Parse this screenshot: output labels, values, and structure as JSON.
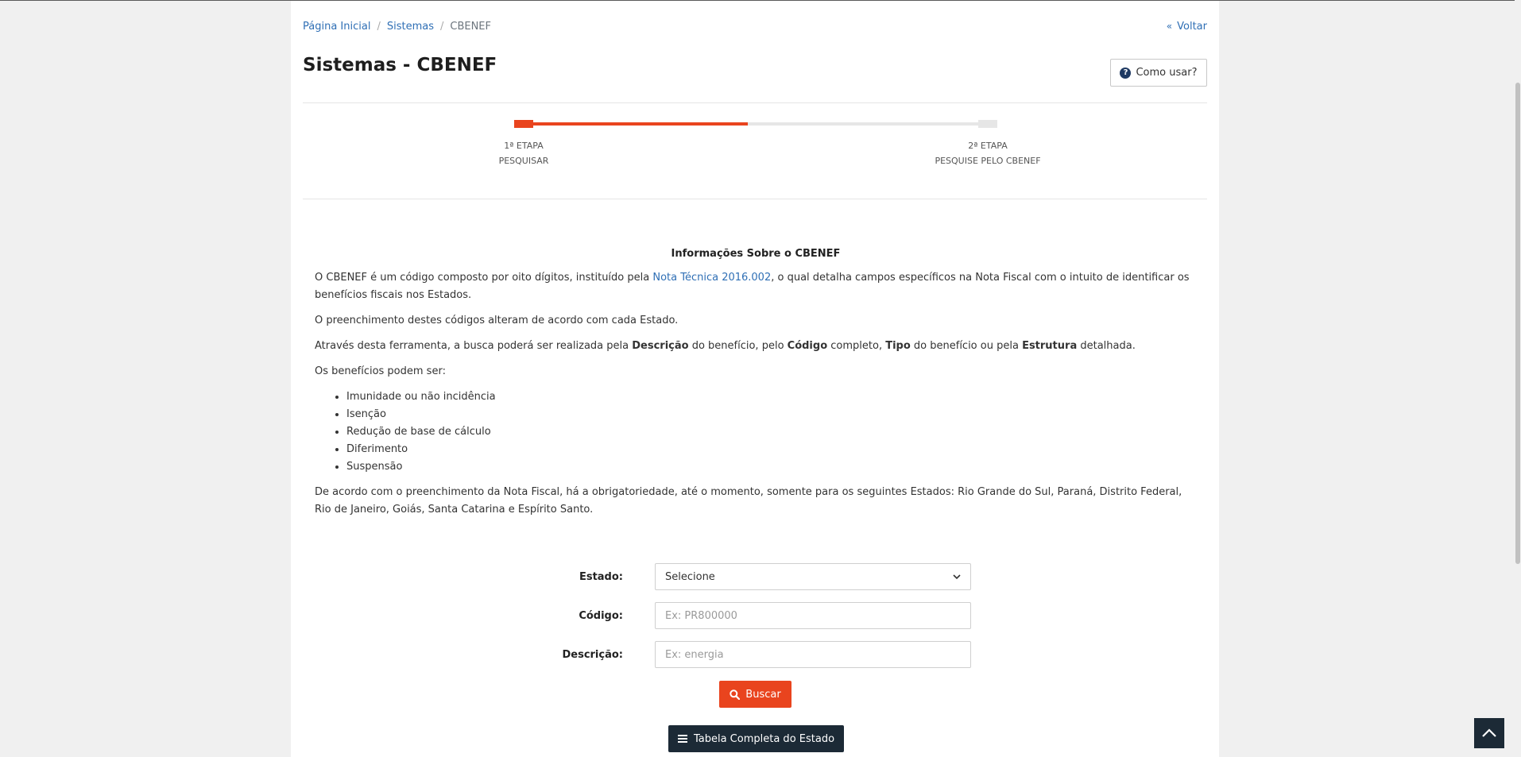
{
  "breadcrumb": {
    "home": "Página Inicial",
    "systems": "Sistemas",
    "current": "CBENEF",
    "separator": "/"
  },
  "back": {
    "chevron": "«",
    "label": "Voltar"
  },
  "header": {
    "title": "Sistemas - CBENEF",
    "help_icon": "question-circle-icon",
    "help_icon_glyph": "?",
    "help_label": "Como usar?"
  },
  "steps": {
    "progress": 0.5,
    "items": [
      {
        "line1": "1ª ETAPA",
        "line2": "PESQUISAR"
      },
      {
        "line1": "2ª ETAPA",
        "line2": "PESQUISE PELO CBENEF"
      }
    ]
  },
  "info": {
    "heading": "Informações Sobre o CBENEF",
    "p1_before": "O CBENEF é um código composto por oito dígitos, instituído pela ",
    "p1_link": "Nota Técnica 2016.002",
    "p1_after": ", o qual detalha campos específicos na Nota Fiscal com o intuito de identificar os benefícios fiscais nos Estados.",
    "p2": "O preenchimento destes códigos alteram de acordo com cada Estado.",
    "p3_a": "Através desta ferramenta, a busca poderá ser realizada pela ",
    "p3_b": "Descrição",
    "p3_c": " do benefício, pelo ",
    "p3_d": "Código",
    "p3_e": " completo, ",
    "p3_f": "Tipo",
    "p3_g": " do benefício ou pela ",
    "p3_h": "Estrutura",
    "p3_i": " detalhada.",
    "p4": "Os benefícios podem ser:",
    "benefits": [
      "Imunidade ou não incidência",
      "Isenção",
      "Redução de base de cálculo",
      "Diferimento",
      "Suspensão"
    ],
    "p5": "De acordo com o preenchimento da Nota Fiscal, há a obrigatoriedade, até o momento, somente para os seguintes Estados: Rio Grande do Sul, Paraná, Distrito Federal, Rio de Janeiro, Goiás, Santa Catarina e Espírito Santo."
  },
  "form": {
    "state_label": "Estado:",
    "state_value": "Selecione",
    "code_label": "Código:",
    "code_placeholder": "Ex: PR800000",
    "desc_label": "Descrição:",
    "desc_placeholder": "Ex: energia",
    "search_label": "Buscar",
    "search_icon": "search-icon",
    "table_label": "Tabela Completa do Estado",
    "table_icon": "menu-icon"
  },
  "back_to_top_icon": "chevron-up-icon",
  "colors": {
    "accent": "#e9441e",
    "link": "#2f6fb5",
    "dark": "#1c2a36",
    "help_icon": "#1f3a63"
  }
}
